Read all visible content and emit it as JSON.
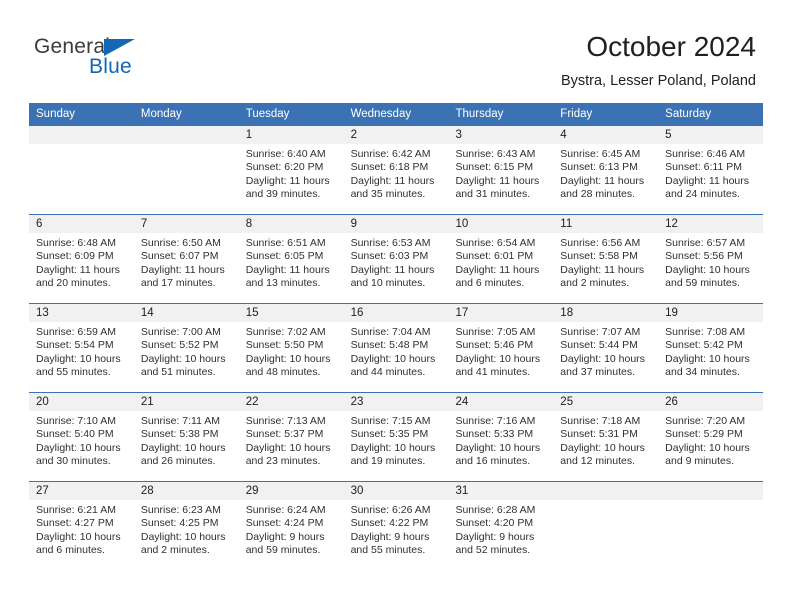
{
  "brand": {
    "name_part1": "General",
    "name_part2": "Blue",
    "accent_color": "#1268b3"
  },
  "header": {
    "title": "October 2024",
    "subtitle": "Bystra, Lesser Poland, Poland"
  },
  "theme": {
    "header_blue": "#3b72b4",
    "daynum_band": "#f1f1f1"
  },
  "weekdays": [
    "Sunday",
    "Monday",
    "Tuesday",
    "Wednesday",
    "Thursday",
    "Friday",
    "Saturday"
  ],
  "weeks": [
    [
      {
        "day": "",
        "sunrise": "",
        "sunset": "",
        "daylight_1": "",
        "daylight_2": ""
      },
      {
        "day": "",
        "sunrise": "",
        "sunset": "",
        "daylight_1": "",
        "daylight_2": ""
      },
      {
        "day": "1",
        "sunrise": "Sunrise: 6:40 AM",
        "sunset": "Sunset: 6:20 PM",
        "daylight_1": "Daylight: 11 hours",
        "daylight_2": "and 39 minutes."
      },
      {
        "day": "2",
        "sunrise": "Sunrise: 6:42 AM",
        "sunset": "Sunset: 6:18 PM",
        "daylight_1": "Daylight: 11 hours",
        "daylight_2": "and 35 minutes."
      },
      {
        "day": "3",
        "sunrise": "Sunrise: 6:43 AM",
        "sunset": "Sunset: 6:15 PM",
        "daylight_1": "Daylight: 11 hours",
        "daylight_2": "and 31 minutes."
      },
      {
        "day": "4",
        "sunrise": "Sunrise: 6:45 AM",
        "sunset": "Sunset: 6:13 PM",
        "daylight_1": "Daylight: 11 hours",
        "daylight_2": "and 28 minutes."
      },
      {
        "day": "5",
        "sunrise": "Sunrise: 6:46 AM",
        "sunset": "Sunset: 6:11 PM",
        "daylight_1": "Daylight: 11 hours",
        "daylight_2": "and 24 minutes."
      }
    ],
    [
      {
        "day": "6",
        "sunrise": "Sunrise: 6:48 AM",
        "sunset": "Sunset: 6:09 PM",
        "daylight_1": "Daylight: 11 hours",
        "daylight_2": "and 20 minutes."
      },
      {
        "day": "7",
        "sunrise": "Sunrise: 6:50 AM",
        "sunset": "Sunset: 6:07 PM",
        "daylight_1": "Daylight: 11 hours",
        "daylight_2": "and 17 minutes."
      },
      {
        "day": "8",
        "sunrise": "Sunrise: 6:51 AM",
        "sunset": "Sunset: 6:05 PM",
        "daylight_1": "Daylight: 11 hours",
        "daylight_2": "and 13 minutes."
      },
      {
        "day": "9",
        "sunrise": "Sunrise: 6:53 AM",
        "sunset": "Sunset: 6:03 PM",
        "daylight_1": "Daylight: 11 hours",
        "daylight_2": "and 10 minutes."
      },
      {
        "day": "10",
        "sunrise": "Sunrise: 6:54 AM",
        "sunset": "Sunset: 6:01 PM",
        "daylight_1": "Daylight: 11 hours",
        "daylight_2": "and 6 minutes."
      },
      {
        "day": "11",
        "sunrise": "Sunrise: 6:56 AM",
        "sunset": "Sunset: 5:58 PM",
        "daylight_1": "Daylight: 11 hours",
        "daylight_2": "and 2 minutes."
      },
      {
        "day": "12",
        "sunrise": "Sunrise: 6:57 AM",
        "sunset": "Sunset: 5:56 PM",
        "daylight_1": "Daylight: 10 hours",
        "daylight_2": "and 59 minutes."
      }
    ],
    [
      {
        "day": "13",
        "sunrise": "Sunrise: 6:59 AM",
        "sunset": "Sunset: 5:54 PM",
        "daylight_1": "Daylight: 10 hours",
        "daylight_2": "and 55 minutes."
      },
      {
        "day": "14",
        "sunrise": "Sunrise: 7:00 AM",
        "sunset": "Sunset: 5:52 PM",
        "daylight_1": "Daylight: 10 hours",
        "daylight_2": "and 51 minutes."
      },
      {
        "day": "15",
        "sunrise": "Sunrise: 7:02 AM",
        "sunset": "Sunset: 5:50 PM",
        "daylight_1": "Daylight: 10 hours",
        "daylight_2": "and 48 minutes."
      },
      {
        "day": "16",
        "sunrise": "Sunrise: 7:04 AM",
        "sunset": "Sunset: 5:48 PM",
        "daylight_1": "Daylight: 10 hours",
        "daylight_2": "and 44 minutes."
      },
      {
        "day": "17",
        "sunrise": "Sunrise: 7:05 AM",
        "sunset": "Sunset: 5:46 PM",
        "daylight_1": "Daylight: 10 hours",
        "daylight_2": "and 41 minutes."
      },
      {
        "day": "18",
        "sunrise": "Sunrise: 7:07 AM",
        "sunset": "Sunset: 5:44 PM",
        "daylight_1": "Daylight: 10 hours",
        "daylight_2": "and 37 minutes."
      },
      {
        "day": "19",
        "sunrise": "Sunrise: 7:08 AM",
        "sunset": "Sunset: 5:42 PM",
        "daylight_1": "Daylight: 10 hours",
        "daylight_2": "and 34 minutes."
      }
    ],
    [
      {
        "day": "20",
        "sunrise": "Sunrise: 7:10 AM",
        "sunset": "Sunset: 5:40 PM",
        "daylight_1": "Daylight: 10 hours",
        "daylight_2": "and 30 minutes."
      },
      {
        "day": "21",
        "sunrise": "Sunrise: 7:11 AM",
        "sunset": "Sunset: 5:38 PM",
        "daylight_1": "Daylight: 10 hours",
        "daylight_2": "and 26 minutes."
      },
      {
        "day": "22",
        "sunrise": "Sunrise: 7:13 AM",
        "sunset": "Sunset: 5:37 PM",
        "daylight_1": "Daylight: 10 hours",
        "daylight_2": "and 23 minutes."
      },
      {
        "day": "23",
        "sunrise": "Sunrise: 7:15 AM",
        "sunset": "Sunset: 5:35 PM",
        "daylight_1": "Daylight: 10 hours",
        "daylight_2": "and 19 minutes."
      },
      {
        "day": "24",
        "sunrise": "Sunrise: 7:16 AM",
        "sunset": "Sunset: 5:33 PM",
        "daylight_1": "Daylight: 10 hours",
        "daylight_2": "and 16 minutes."
      },
      {
        "day": "25",
        "sunrise": "Sunrise: 7:18 AM",
        "sunset": "Sunset: 5:31 PM",
        "daylight_1": "Daylight: 10 hours",
        "daylight_2": "and 12 minutes."
      },
      {
        "day": "26",
        "sunrise": "Sunrise: 7:20 AM",
        "sunset": "Sunset: 5:29 PM",
        "daylight_1": "Daylight: 10 hours",
        "daylight_2": "and 9 minutes."
      }
    ],
    [
      {
        "day": "27",
        "sunrise": "Sunrise: 6:21 AM",
        "sunset": "Sunset: 4:27 PM",
        "daylight_1": "Daylight: 10 hours",
        "daylight_2": "and 6 minutes."
      },
      {
        "day": "28",
        "sunrise": "Sunrise: 6:23 AM",
        "sunset": "Sunset: 4:25 PM",
        "daylight_1": "Daylight: 10 hours",
        "daylight_2": "and 2 minutes."
      },
      {
        "day": "29",
        "sunrise": "Sunrise: 6:24 AM",
        "sunset": "Sunset: 4:24 PM",
        "daylight_1": "Daylight: 9 hours",
        "daylight_2": "and 59 minutes."
      },
      {
        "day": "30",
        "sunrise": "Sunrise: 6:26 AM",
        "sunset": "Sunset: 4:22 PM",
        "daylight_1": "Daylight: 9 hours",
        "daylight_2": "and 55 minutes."
      },
      {
        "day": "31",
        "sunrise": "Sunrise: 6:28 AM",
        "sunset": "Sunset: 4:20 PM",
        "daylight_1": "Daylight: 9 hours",
        "daylight_2": "and 52 minutes."
      },
      {
        "day": "",
        "sunrise": "",
        "sunset": "",
        "daylight_1": "",
        "daylight_2": ""
      },
      {
        "day": "",
        "sunrise": "",
        "sunset": "",
        "daylight_1": "",
        "daylight_2": ""
      }
    ]
  ]
}
